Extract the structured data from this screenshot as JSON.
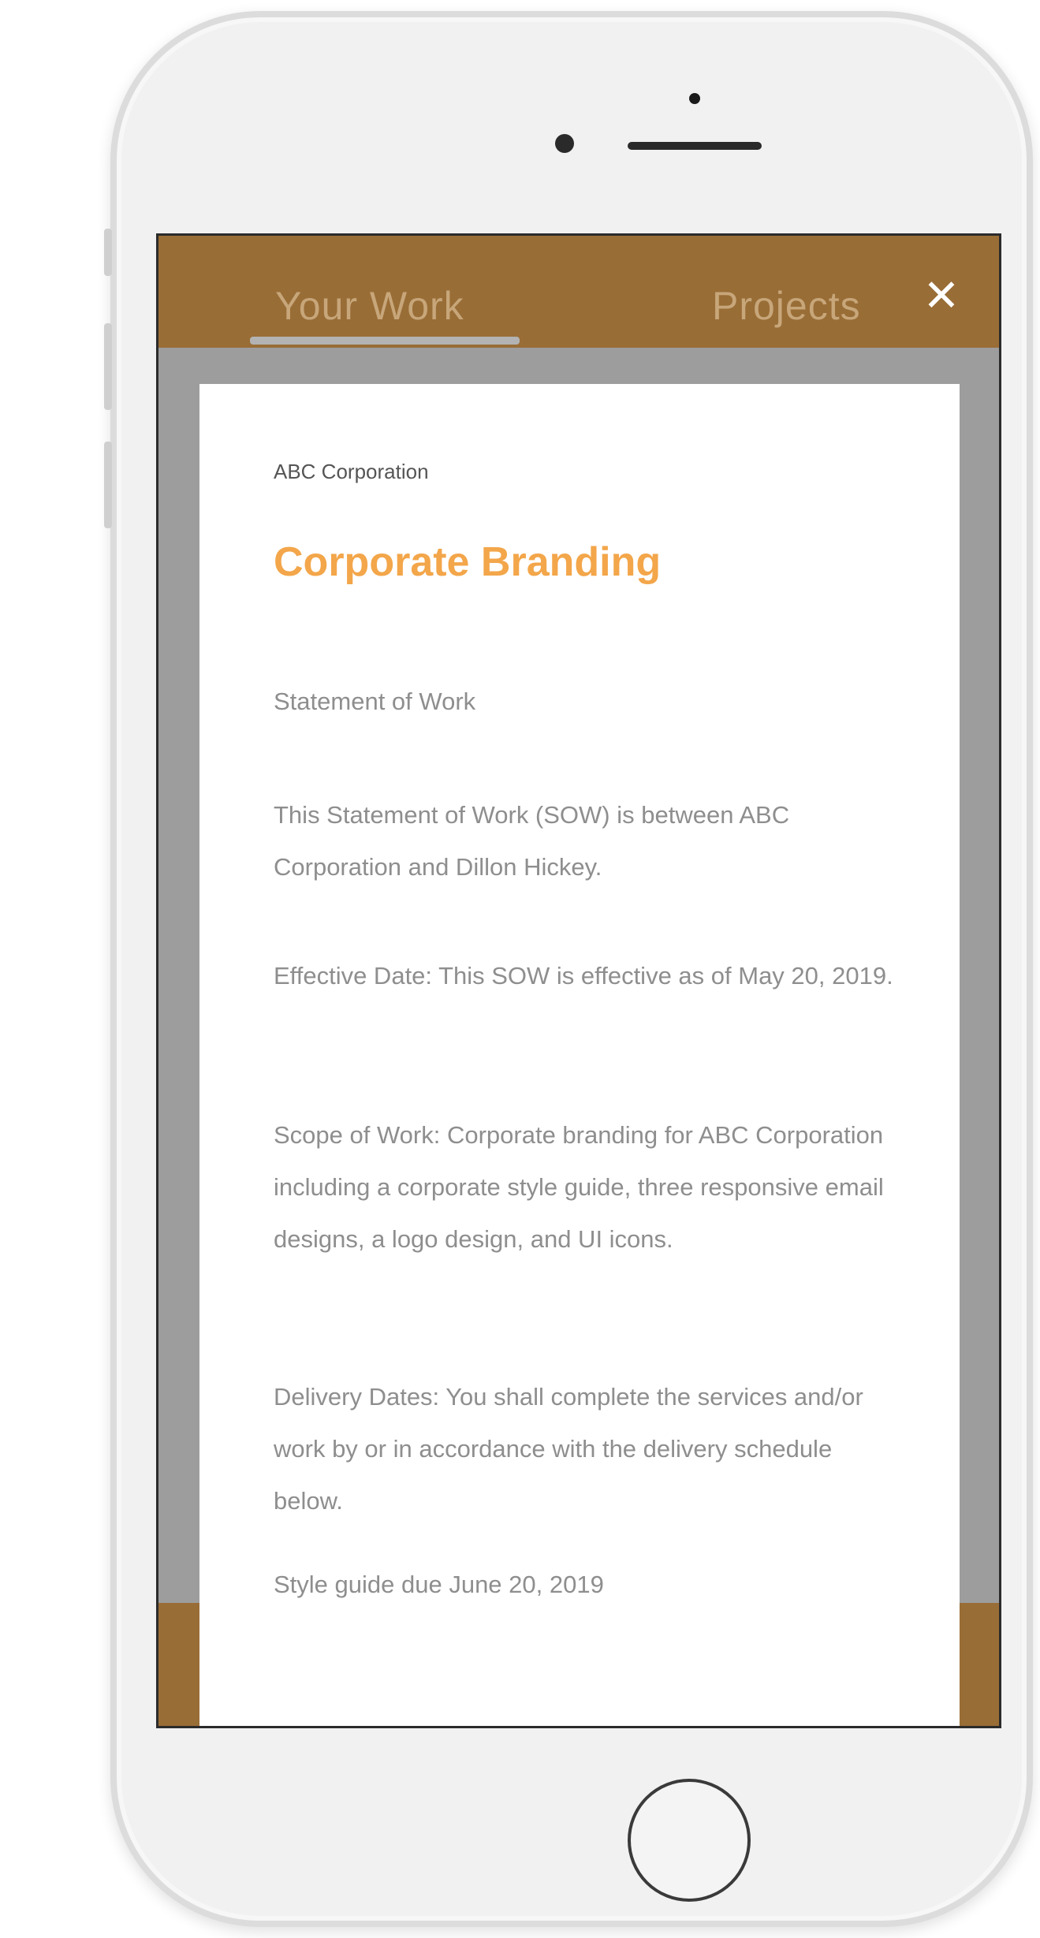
{
  "tabs": {
    "your_work": "Your Work",
    "projects": "Projects"
  },
  "close_label": "✕",
  "document": {
    "company": "ABC Corporation",
    "title": "Corporate Branding",
    "heading": "Statement of Work",
    "paragraph_1": "This Statement of Work (SOW) is between ABC Corporation and Dillon Hickey.",
    "paragraph_2": "Effective Date: This SOW is effective as of May 20, 2019.",
    "paragraph_3": "Scope of Work: Corporate branding for ABC Corporation including a corporate style guide, three responsive email designs, a logo design, and UI icons.",
    "paragraph_4": "Delivery Dates: You shall complete the services and/or work by or in accordance with the delivery schedule below.",
    "paragraph_5": "Style guide due June 20, 2019"
  },
  "colors": {
    "header_brown": "#996d36",
    "title_orange": "#f3a64a",
    "overlay_gray": "#9d9d9d"
  }
}
